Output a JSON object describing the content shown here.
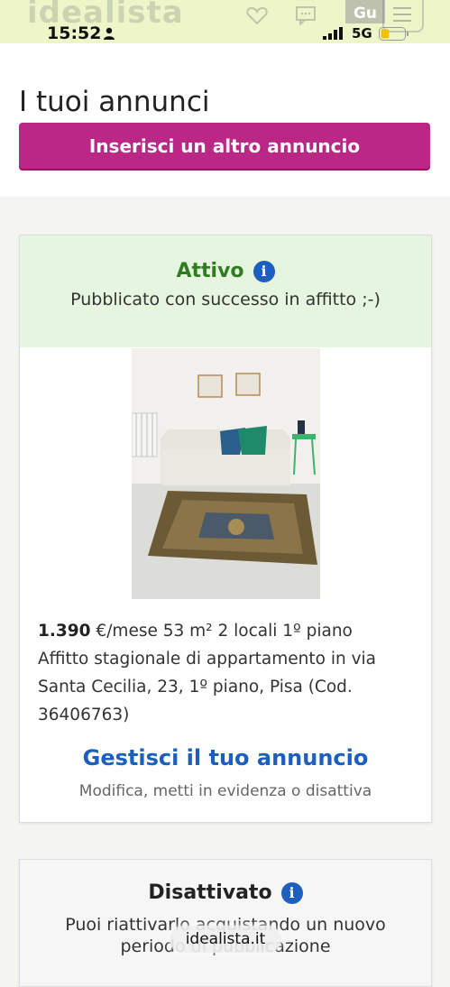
{
  "status_bar": {
    "time": "15:52",
    "network": "5G"
  },
  "header": {
    "logo": "idealista",
    "user_initials": "Gu",
    "icons": [
      "heart-icon",
      "chat-icon",
      "menu-icon"
    ]
  },
  "page": {
    "title": "I tuoi annunci",
    "add_button_label": "Inserisci un altro annuncio"
  },
  "listing": {
    "status": "Attivo",
    "status_message": "Pubblicato con successo in affitto ;-)",
    "price": "1.390",
    "details": "€/mese 53 m² 2 locali 1º piano",
    "description": "Affitto stagionale di appartamento in via Santa Cecilia, 23, 1º piano, Pisa (Cod. 36406763)",
    "manage_label": "Gestisci il tuo annuncio",
    "manage_sub": "Modifica, metti in evidenza o disattiva"
  },
  "listing2": {
    "status": "Disattivato",
    "status_message": "Puoi riattivarlo acquistando un nuovo periodo di pubblicazione"
  },
  "toast": {
    "text": "idealista.it"
  },
  "colors": {
    "brand_magenta": "#bb2785",
    "active_green": "#2f7d20",
    "link_blue": "#1d5fbf",
    "active_band": "#e6f5df"
  }
}
